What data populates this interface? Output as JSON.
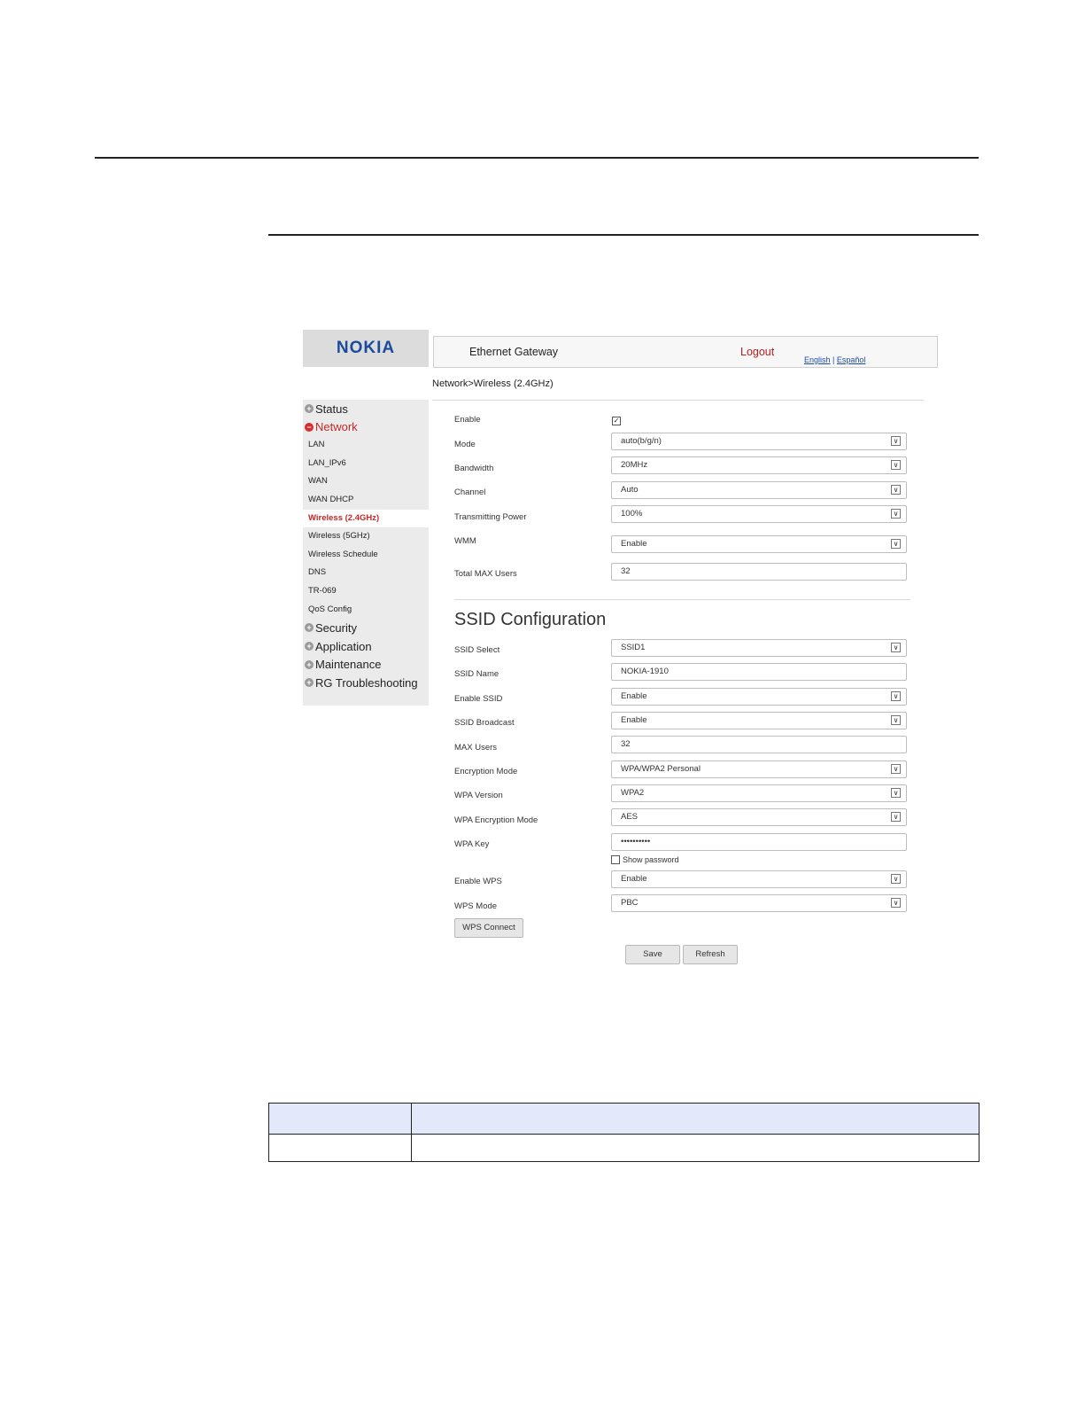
{
  "header": {
    "logo": "NOKIA",
    "app_title": "Ethernet Gateway",
    "logout": "Logout",
    "lang_english": "English",
    "lang_sep": "|",
    "lang_spanish": "Español"
  },
  "breadcrumb": "Network>Wireless (2.4GHz)",
  "sidebar": {
    "items": [
      {
        "label": "Status",
        "type": "top"
      },
      {
        "label": "Network",
        "type": "top",
        "active": true
      },
      {
        "label": "LAN",
        "type": "sub"
      },
      {
        "label": "LAN_IPv6",
        "type": "sub"
      },
      {
        "label": "WAN",
        "type": "sub"
      },
      {
        "label": "WAN DHCP",
        "type": "sub"
      },
      {
        "label": "Wireless (2.4GHz)",
        "type": "sub",
        "selected": true
      },
      {
        "label": "Wireless (5GHz)",
        "type": "sub"
      },
      {
        "label": "Wireless Schedule",
        "type": "sub"
      },
      {
        "label": "DNS",
        "type": "sub"
      },
      {
        "label": "TR-069",
        "type": "sub"
      },
      {
        "label": "QoS Config",
        "type": "sub"
      },
      {
        "label": "Security",
        "type": "top"
      },
      {
        "label": "Application",
        "type": "top"
      },
      {
        "label": "Maintenance",
        "type": "top"
      },
      {
        "label": "RG Troubleshooting",
        "type": "top"
      }
    ]
  },
  "wireless": {
    "enable_label": "Enable",
    "enable_checked": true,
    "mode_label": "Mode",
    "mode_value": "auto(b/g/n)",
    "bandwidth_label": "Bandwidth",
    "bandwidth_value": "20MHz",
    "channel_label": "Channel",
    "channel_value": "Auto",
    "power_label": "Transmitting Power",
    "power_value": "100%",
    "wmm_label": "WMM",
    "wmm_value": "Enable",
    "max_users_label": "Total MAX Users",
    "max_users_value": "32"
  },
  "ssid": {
    "title": "SSID Configuration",
    "select_label": "SSID Select",
    "select_value": "SSID1",
    "name_label": "SSID Name",
    "name_value": "NOKIA-1910",
    "enable_label": "Enable SSID",
    "enable_value": "Enable",
    "broadcast_label": "SSID Broadcast",
    "broadcast_value": "Enable",
    "max_users_label": "MAX Users",
    "max_users_value": "32",
    "enc_mode_label": "Encryption Mode",
    "enc_mode_value": "WPA/WPA2 Personal",
    "wpa_version_label": "WPA Version",
    "wpa_version_value": "WPA2",
    "wpa_enc_label": "WPA Encryption Mode",
    "wpa_enc_value": "AES",
    "wpa_key_label": "WPA Key",
    "wpa_key_value": "••••••••••",
    "show_password": "Show password",
    "enable_wps_label": "Enable WPS",
    "enable_wps_value": "Enable",
    "wps_mode_label": "WPS Mode",
    "wps_mode_value": "PBC",
    "wps_connect": "WPS Connect"
  },
  "actions": {
    "save": "Save",
    "refresh": "Refresh"
  }
}
